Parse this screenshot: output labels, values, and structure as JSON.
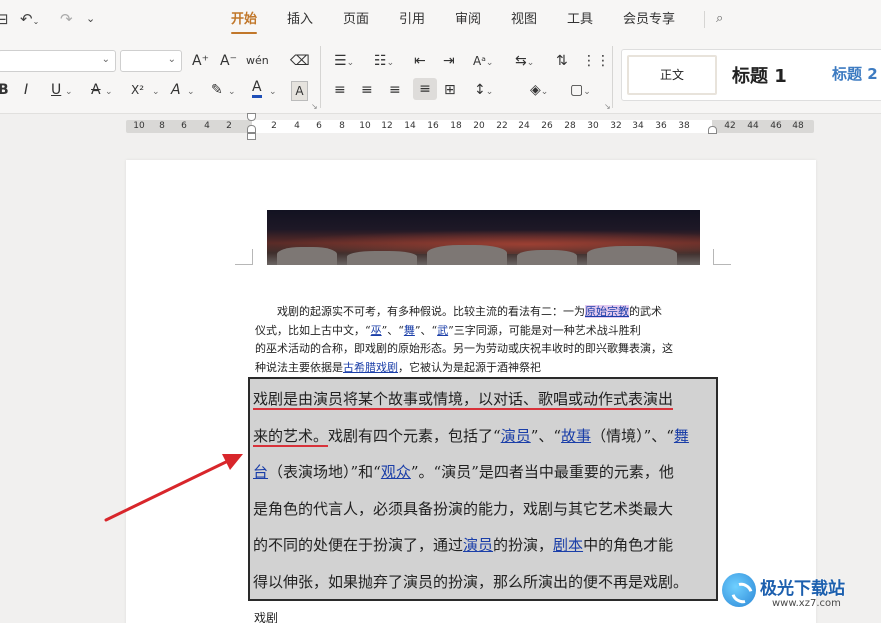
{
  "titlebar": {
    "tabs": [
      "开始",
      "插入",
      "页面",
      "引用",
      "审阅",
      "视图",
      "工具",
      "会员专享"
    ],
    "active_tab": "开始",
    "icons": [
      "save-icon",
      "undo-icon",
      "redo-icon",
      "more-icon",
      "search-icon"
    ]
  },
  "ribbon": {
    "font_row1": [
      "A⁺",
      "A⁻",
      "wén",
      "⌫"
    ],
    "font_row2": [
      "B",
      "I",
      "U",
      "A",
      "X²",
      "A",
      "✎",
      "A",
      "A"
    ],
    "font_color": "#1f4fb8",
    "styles": {
      "normal": "正文",
      "heading1": "标题 1",
      "heading2": "标题 2"
    }
  },
  "ruler": {
    "left_ticks": [
      "10",
      "8",
      "6",
      "4",
      "2"
    ],
    "mid_ticks": [
      "2",
      "4",
      "6",
      "8",
      "10",
      "12",
      "14",
      "16",
      "18",
      "20",
      "22",
      "24",
      "26",
      "28",
      "30",
      "32",
      "34",
      "36",
      "38"
    ],
    "right_ticks": [
      "42",
      "44",
      "46",
      "48"
    ]
  },
  "document": {
    "small_para": [
      [
        {
          "t": "　　戏剧的起源实不可考，有多种假说。比较主流的看法有二：一为"
        },
        {
          "t": "原始宗教",
          "c": "lk hl-pink"
        },
        {
          "t": "的武术"
        }
      ],
      [
        {
          "t": "仪式，比如上古中文，“"
        },
        {
          "t": "巫",
          "c": "lk"
        },
        {
          "t": "”、“"
        },
        {
          "t": "舞",
          "c": "lk"
        },
        {
          "t": "”、“"
        },
        {
          "t": "武",
          "c": "lk"
        },
        {
          "t": "”三字同源，可能是对一种艺术战斗胜利"
        }
      ],
      [
        {
          "t": "的巫术活动的合称，即戏剧的原始形态。另一为劳动或庆祝丰收时的即兴歌舞表演，这"
        }
      ],
      [
        {
          "t": "种说法主要依据是"
        },
        {
          "t": "古希腊戏剧",
          "c": "lk"
        },
        {
          "t": "，它被认为是起源于酒神祭祀"
        }
      ]
    ],
    "big_para": [
      [
        {
          "t": "戏剧是由演员将某个故事或情境，以对话、歌唱或动作式表演出",
          "c": "redline"
        }
      ],
      [
        {
          "t": "来的艺术。",
          "c": "redline"
        },
        {
          "t": "戏剧有四个元素，包括了“"
        },
        {
          "t": "演员",
          "c": "lk"
        },
        {
          "t": "”、“"
        },
        {
          "t": "故事",
          "c": "lk"
        },
        {
          "t": "（情境）”、“"
        },
        {
          "t": "舞",
          "c": "lk"
        }
      ],
      [
        {
          "t": "台",
          "c": "lk"
        },
        {
          "t": "（表演场地）”和“"
        },
        {
          "t": "观众",
          "c": "lk"
        },
        {
          "t": "”。“演员”是四者当中最重要的元素，他"
        }
      ],
      [
        {
          "t": "是角色的代言人，必须具备扮演的能力，戏剧与其它艺术类最大"
        }
      ],
      [
        {
          "t": "的不同的处便在于扮演了，通过"
        },
        {
          "t": "演员",
          "c": "lk"
        },
        {
          "t": "的扮演，"
        },
        {
          "t": "剧本",
          "c": "lk"
        },
        {
          "t": "中的角色才能"
        }
      ],
      [
        {
          "t": "得以伸张，如果抛弃了演员的扮演，那么所演出的便不再是戏剧。"
        }
      ]
    ],
    "after_text": "戏剧"
  },
  "watermark": {
    "title": "极光下载站",
    "url": "www.xz7.com"
  }
}
